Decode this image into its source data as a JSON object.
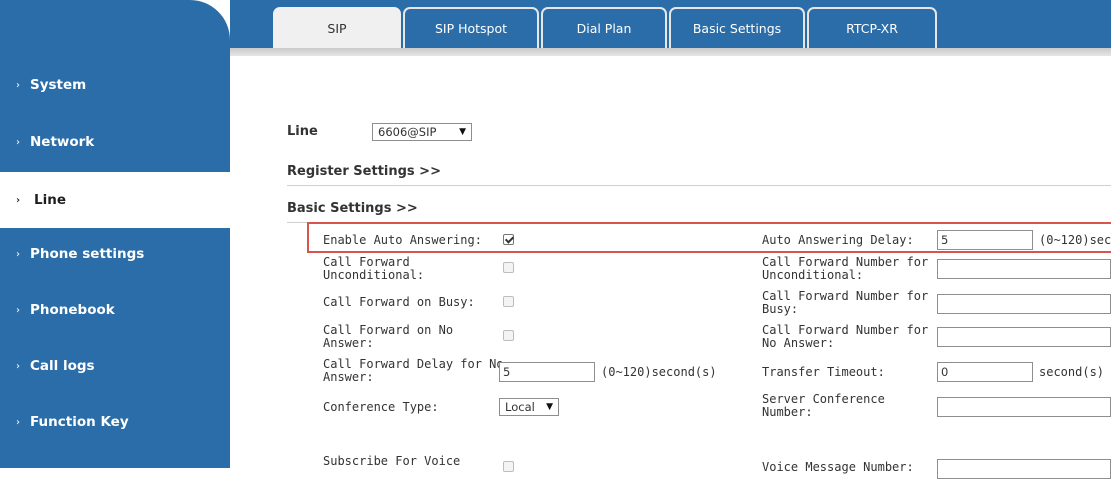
{
  "sidebar": {
    "items": [
      {
        "label": "System"
      },
      {
        "label": "Network"
      },
      {
        "label": "Line"
      },
      {
        "label": "Phone settings"
      },
      {
        "label": "Phonebook"
      },
      {
        "label": "Call logs"
      },
      {
        "label": "Function Key"
      }
    ]
  },
  "tabs": [
    {
      "label": "SIP"
    },
    {
      "label": "SIP Hotspot"
    },
    {
      "label": "Dial Plan"
    },
    {
      "label": "Basic Settings"
    },
    {
      "label": "RTCP-XR"
    }
  ],
  "colors": {
    "accent": "#2b6da8",
    "highlight": "#d9534f"
  },
  "icons": {
    "chevron": "chevron-right-icon",
    "dropdown": "triangle-down-icon"
  },
  "line": {
    "label": "Line",
    "value": "6606@SIP"
  },
  "sections": {
    "register": "Register Settings >>",
    "basic": "Basic Settings >>"
  },
  "form": {
    "auto_answer": {
      "label": "Enable Auto Answering:",
      "checked": true
    },
    "auto_answer_delay": {
      "label": "Auto Answering Delay:",
      "value": "5",
      "unit": "(0~120)sec"
    },
    "cf_unconditional": {
      "label_l1": "Call Forward",
      "label_l2": "Unconditional:",
      "checked": false
    },
    "cf_number_unconditional": {
      "label_l1": "Call Forward Number for",
      "label_l2": "Unconditional:",
      "value": ""
    },
    "cf_busy": {
      "label": "Call Forward on Busy:",
      "checked": false
    },
    "cf_number_busy": {
      "label_l1": "Call Forward Number for",
      "label_l2": "Busy:",
      "value": ""
    },
    "cf_no_answer": {
      "label_l1": "Call Forward on No",
      "label_l2": "Answer:",
      "checked": false
    },
    "cf_number_no_answer": {
      "label_l1": "Call Forward Number for",
      "label_l2": "No Answer:",
      "value": ""
    },
    "cf_delay": {
      "label_l1": "Call Forward Delay for No",
      "label_l2": "Answer:",
      "value": "5",
      "unit": "(0~120)second(s)"
    },
    "transfer_timeout": {
      "label": "Transfer Timeout:",
      "value": "0",
      "unit": "second(s)"
    },
    "conference_type": {
      "label": "Conference Type:",
      "value": "Local"
    },
    "server_conference": {
      "label_l1": "Server Conference",
      "label_l2": "Number:",
      "value": ""
    },
    "subscribe_voice": {
      "label": "Subscribe For Voice",
      "checked": false
    },
    "voice_message": {
      "label": "Voice Message Number:",
      "value": ""
    }
  }
}
